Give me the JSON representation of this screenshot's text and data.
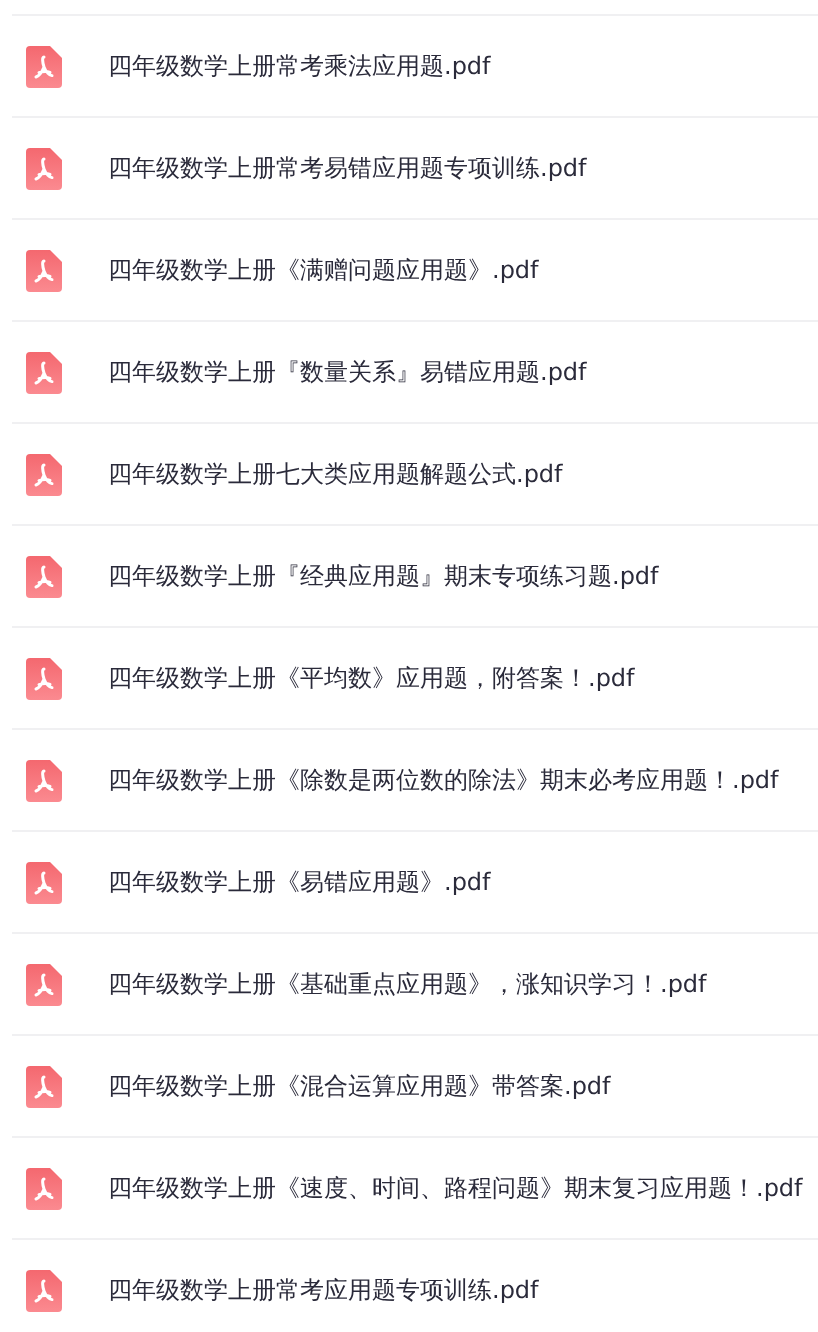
{
  "files": [
    {
      "name": "四年级数学上册常考乘法应用题.pdf",
      "kind": "pdf"
    },
    {
      "name": "四年级数学上册常考易错应用题专项训练.pdf",
      "kind": "pdf"
    },
    {
      "name": "四年级数学上册《满赠问题应用题》.pdf",
      "kind": "pdf"
    },
    {
      "name": "四年级数学上册『数量关系』易错应用题.pdf",
      "kind": "pdf"
    },
    {
      "name": "四年级数学上册七大类应用题解题公式.pdf",
      "kind": "pdf"
    },
    {
      "name": "四年级数学上册『经典应用题』期末专项练习题.pdf",
      "kind": "pdf"
    },
    {
      "name": "四年级数学上册《平均数》应用题，附答案！.pdf",
      "kind": "pdf"
    },
    {
      "name": "四年级数学上册《除数是两位数的除法》期末必考应用题！.pdf",
      "kind": "pdf"
    },
    {
      "name": "四年级数学上册《易错应用题》.pdf",
      "kind": "pdf"
    },
    {
      "name": "四年级数学上册《基础重点应用题》，涨知识学习！.pdf",
      "kind": "pdf"
    },
    {
      "name": "四年级数学上册《混合运算应用题》带答案.pdf",
      "kind": "pdf"
    },
    {
      "name": "四年级数学上册《速度、时间、路程问题》期末复习应用题！.pdf",
      "kind": "pdf"
    },
    {
      "name": "四年级数学上册常考应用题专项训练.pdf",
      "kind": "pdf"
    }
  ]
}
